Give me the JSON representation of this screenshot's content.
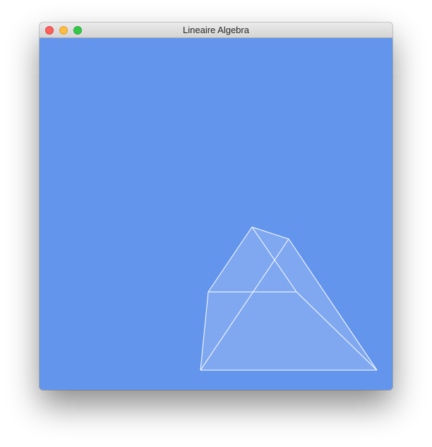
{
  "window": {
    "title": "Lineaire Algebra",
    "background_color": "#6495ed"
  },
  "titlebar_buttons": [
    {
      "name": "close",
      "color": "#fc605b"
    },
    {
      "name": "minimize",
      "color": "#fdbc40"
    },
    {
      "name": "zoom",
      "color": "#34c84a"
    }
  ],
  "scene": {
    "object": "wireframe-solid",
    "edge_color": "#ffffff",
    "face_fill": "rgba(255,255,255,0.18)"
  }
}
